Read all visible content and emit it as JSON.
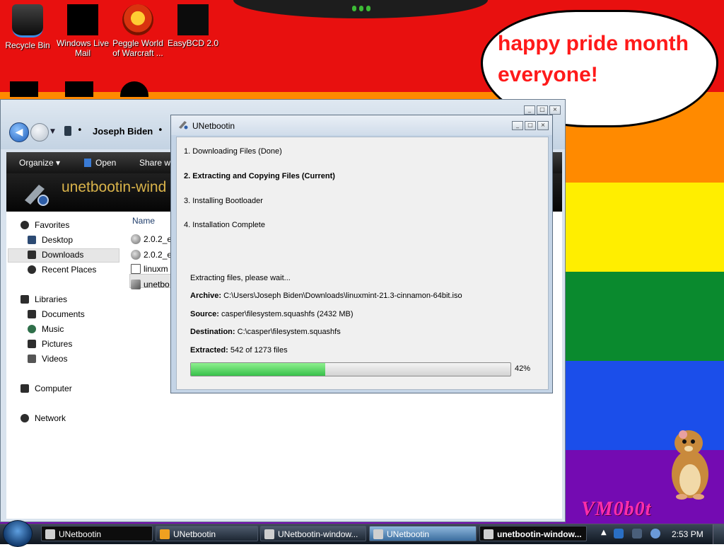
{
  "desktop": {
    "icons": [
      {
        "label": "Recycle Bin",
        "icon": "recycle-bin-icon"
      },
      {
        "label": "Windows Live Mail",
        "icon": "windows-live-mail-icon"
      },
      {
        "label": "Peggle World of Warcraft ...",
        "icon": "peggle-icon"
      },
      {
        "label": "EasyBCD 2.0",
        "icon": "easybcd-icon"
      }
    ],
    "bubble_text": "happy pride month everyone!",
    "watermark": "VM0b0t",
    "stripe_colors": [
      "#e8100f",
      "#ff8a00",
      "#ffee00",
      "#0a8a2e",
      "#1b4eea",
      "#740bb2"
    ]
  },
  "explorer": {
    "breadcrumb": "Joseph Biden",
    "toolbar": {
      "organize": "Organize",
      "open": "Open",
      "share": "Share wi"
    },
    "folder_title": "unetbootin-wind",
    "nav": {
      "favorites": "Favorites",
      "desktop": "Desktop",
      "downloads": "Downloads",
      "recent": "Recent Places",
      "libraries": "Libraries",
      "documents": "Documents",
      "music": "Music",
      "pictures": "Pictures",
      "videos": "Videos",
      "computer": "Computer",
      "network": "Network"
    },
    "column_name": "Name",
    "files": [
      "2.0.2_e",
      "2.0.2_e",
      "linuxm",
      "unetbo"
    ]
  },
  "unetbootin": {
    "title": "UNetbootin",
    "steps": [
      "1. Downloading Files (Done)",
      "2. Extracting and Copying Files (Current)",
      "3. Installing Bootloader",
      "4. Installation Complete"
    ],
    "status": "Extracting files, please wait...",
    "archive_label": "Archive:",
    "archive_value": "C:\\Users\\Joseph Biden\\Downloads\\linuxmint-21.3-cinnamon-64bit.iso",
    "source_label": "Source:",
    "source_value": "casper\\filesystem.squashfs (2432 MB)",
    "destination_label": "Destination:",
    "destination_value": "C:\\casper\\filesystem.squashfs",
    "extracted_label": "Extracted:",
    "extracted_value": "542 of 1273 files",
    "progress": 42,
    "progress_text": "42%"
  },
  "taskbar": {
    "tasks": [
      {
        "label": "UNetbootin",
        "style": "dark"
      },
      {
        "label": "UNetbootin",
        "style": "normal"
      },
      {
        "label": "UNetbootin-window...",
        "style": "normal"
      },
      {
        "label": "UNetbootin",
        "style": "active"
      },
      {
        "label": "unetbootin-window...",
        "style": "dark"
      }
    ],
    "clock": "2:53 PM"
  }
}
